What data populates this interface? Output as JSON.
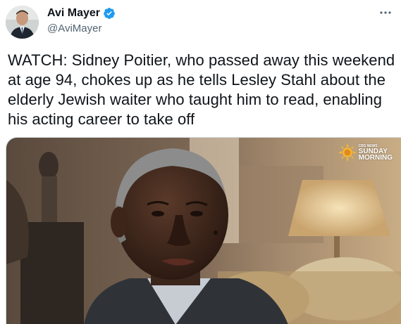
{
  "author": {
    "display_name": "Avi Mayer",
    "handle": "@AviMayer",
    "verified": true,
    "avatar_icon": "profile-photo"
  },
  "tweet": {
    "text": "WATCH: Sidney Poitier, who passed away this weekend at age 94, chokes up as he tells Lesley Stahl about the elderly Jewish waiter who taught him to read, enabling his acting career to take off"
  },
  "media": {
    "type": "video-still",
    "watermark": {
      "small_line": "CBS NEWS",
      "line1": "SUNDAY",
      "line2": "MORNING"
    }
  },
  "colors": {
    "text": "#0f1419",
    "secondary": "#536471",
    "verified": "#1d9bf0"
  }
}
